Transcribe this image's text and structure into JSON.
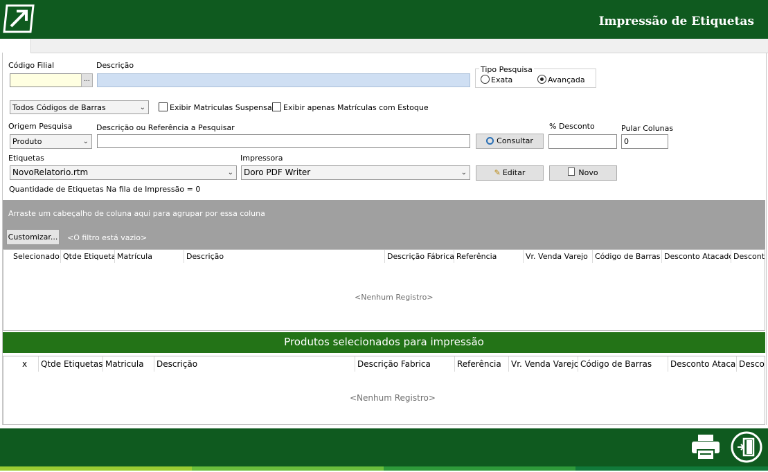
{
  "header": {
    "title": "Impressão de Etiquetas"
  },
  "filters": {
    "codigo_filial_label": "Código Filial",
    "codigo_filial_value": "",
    "browse_label": "...",
    "descricao_label": "Descrição",
    "descricao_value": "",
    "tipo_pesquisa": {
      "label": "Tipo Pesquisa",
      "options": [
        "Exata",
        "Avançada"
      ],
      "selected": "Avançada"
    },
    "barcode_combo": "Todos Códigos de Barras",
    "chk_suspensas": "Exibir Matriculas Suspensas",
    "chk_estoque": "Exibir apenas Matrículas com Estoque",
    "origem_label": "Origem Pesquisa",
    "origem_value": "Produto",
    "desc_ref_label": "Descrição ou Referência a Pesquisar",
    "desc_ref_value": "",
    "consultar_button": "Consultar",
    "desconto_label": "% Desconto",
    "desconto_value": "",
    "pular_label": "Pular Colunas",
    "pular_value": "0",
    "etiquetas_label": "Etiquetas",
    "etiquetas_value": "NovoRelatorio.rtm",
    "impressora_label": "Impressora",
    "impressora_value": "Doro PDF Writer",
    "editar_button": "Editar",
    "novo_button": "Novo",
    "fila_text": "Quantidade de Etiquetas Na fila de Impressão = 0"
  },
  "grid1": {
    "group_hint": "Arraste um cabeçalho de coluna aqui para agrupar por essa coluna",
    "customize_button": "Customizar...",
    "filter_empty": "<O filtro está vazio>",
    "columns": [
      "Selecionado",
      "Qtde Etiquetas",
      "Matrícula",
      "Descrição",
      "Descrição Fábrica",
      "Referência",
      "Vr. Venda Varejo",
      "Código de Barras",
      "Desconto Atacado",
      "Desconto"
    ],
    "empty_text": "<Nenhum Registro>"
  },
  "grid2": {
    "title": "Produtos selecionados para impressão",
    "columns": [
      "x",
      "Qtde Etiquetas",
      "Matricula",
      "Descrição",
      "Descrição Fabrica",
      "Referência",
      "Vr. Venda Varejo",
      "Código de Barras",
      "Desconto Atacad",
      "Descon"
    ],
    "empty_text": "<Nenhum Registro>"
  },
  "footer": {
    "icons": [
      "printer-icon",
      "exit-icon"
    ]
  },
  "colors": {
    "header_green": "#0f5a1f",
    "band_green": "#237317",
    "input_yellow": "#ffffe1",
    "input_blue": "#cfdff3"
  }
}
